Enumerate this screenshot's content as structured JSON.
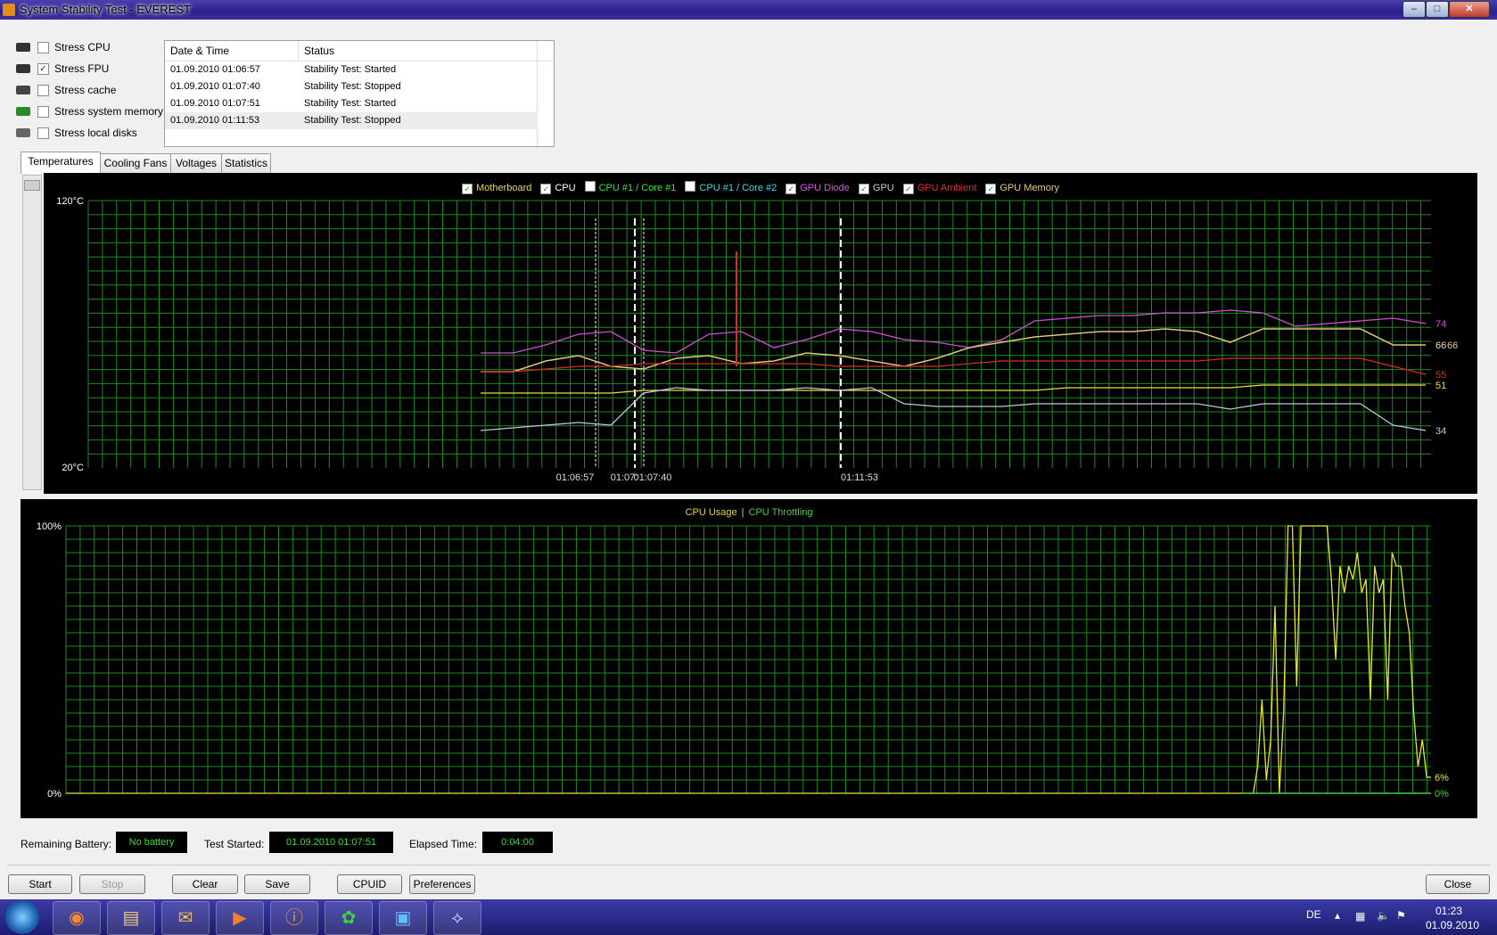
{
  "window": {
    "title": "System Stability Test - EVEREST"
  },
  "stress_options": [
    {
      "label": "Stress CPU",
      "checked": false,
      "icon": "cpu-chip-icon"
    },
    {
      "label": "Stress FPU",
      "checked": true,
      "icon": "fpu-chip-icon"
    },
    {
      "label": "Stress cache",
      "checked": false,
      "icon": "cache-chip-icon"
    },
    {
      "label": "Stress system memory",
      "checked": false,
      "icon": "memory-module-icon"
    },
    {
      "label": "Stress local disks",
      "checked": false,
      "icon": "disk-drive-icon"
    }
  ],
  "log": {
    "columns": [
      "Date & Time",
      "Status"
    ],
    "rows": [
      [
        "01.09.2010 01:06:57",
        "Stability Test: Started"
      ],
      [
        "01.09.2010 01:07:40",
        "Stability Test: Stopped"
      ],
      [
        "01.09.2010 01:07:51",
        "Stability Test: Started"
      ],
      [
        "01.09.2010 01:11:53",
        "Stability Test: Stopped"
      ]
    ]
  },
  "tabs": [
    "Temperatures",
    "Cooling Fans",
    "Voltages",
    "Statistics"
  ],
  "active_tab": "Temperatures",
  "chart_data": [
    {
      "type": "line",
      "ylim": [
        20,
        120
      ],
      "ymax_label": "120°C",
      "ymin_label": "20°C",
      "x_markers": [
        "01:06:57",
        "01:07:",
        "01:07:40",
        "01:11:53"
      ],
      "legend": [
        {
          "name": "Motherboard",
          "checked": true,
          "color": "#e8d84a"
        },
        {
          "name": "CPU",
          "checked": true,
          "color": "#ffffff"
        },
        {
          "name": "CPU #1 / Core #1",
          "checked": false,
          "color": "#3fe03f"
        },
        {
          "name": "CPU #1 / Core #2",
          "checked": false,
          "color": "#40d8e8"
        },
        {
          "name": "GPU Diode",
          "checked": true,
          "color": "#e050e0"
        },
        {
          "name": "GPU",
          "checked": true,
          "color": "#c8c8c8"
        },
        {
          "name": "GPU Ambient",
          "checked": true,
          "color": "#e03030"
        },
        {
          "name": "GPU Memory",
          "checked": true,
          "color": "#e8c878"
        }
      ],
      "series": [
        {
          "name": "GPU Diode",
          "color": "#d050d0",
          "end_label": "74",
          "values": [
            63,
            63,
            66,
            70,
            71,
            64,
            63,
            70,
            71,
            65,
            68,
            72,
            71,
            68,
            67,
            65,
            68,
            75,
            76,
            77,
            77,
            78,
            78,
            79,
            78,
            73,
            74,
            75,
            76,
            74
          ]
        },
        {
          "name": "GPU",
          "color": "#e8e0c0",
          "end_label": "66",
          "values": [
            56,
            56,
            60,
            62,
            58,
            57,
            61,
            62,
            59,
            60,
            63,
            62,
            60,
            58,
            61,
            65,
            67,
            69,
            70,
            71,
            71,
            72,
            71,
            67,
            72,
            72,
            72,
            72,
            66,
            66
          ]
        },
        {
          "name": "GPU Memory",
          "color": "#e8c878",
          "end_label": "66",
          "values": [
            56,
            56,
            60,
            62,
            58,
            57,
            61,
            62,
            59,
            60,
            63,
            62,
            60,
            58,
            61,
            65,
            67,
            69,
            70,
            71,
            71,
            72,
            71,
            67,
            72,
            72,
            72,
            72,
            66,
            66
          ]
        },
        {
          "name": "GPU Ambient",
          "color": "#d03020",
          "end_label": "55",
          "values": [
            56,
            56,
            57,
            58,
            58,
            59,
            59,
            59,
            59,
            59,
            59,
            58,
            58,
            58,
            58,
            59,
            60,
            60,
            60,
            60,
            60,
            60,
            60,
            61,
            61,
            61,
            61,
            61,
            58,
            55
          ]
        },
        {
          "name": "Motherboard",
          "color": "#e8e040",
          "end_label": "51",
          "values": [
            48,
            48,
            48,
            48,
            48,
            49,
            49,
            49,
            49,
            49,
            49,
            49,
            49,
            49,
            49,
            49,
            49,
            49,
            50,
            50,
            50,
            50,
            50,
            50,
            51,
            51,
            51,
            51,
            51,
            51
          ]
        },
        {
          "name": "CPU",
          "color": "#b8c8e0",
          "end_label": "34",
          "values": [
            34,
            35,
            36,
            37,
            36,
            48,
            50,
            49,
            49,
            49,
            50,
            49,
            50,
            44,
            43,
            43,
            43,
            44,
            44,
            44,
            44,
            44,
            44,
            42,
            44,
            44,
            44,
            44,
            36,
            34
          ]
        }
      ],
      "spike": {
        "name": "GPU Ambient",
        "value": 101
      }
    },
    {
      "type": "line",
      "ylim": [
        0,
        100
      ],
      "ymax_label": "100%",
      "ymin_label": "0%",
      "legend": [
        {
          "name": "CPU Usage",
          "color": "#e8d830"
        },
        {
          "name": "CPU Throttling",
          "color": "#3fd03f"
        }
      ],
      "series": [
        {
          "name": "CPU Usage",
          "color": "#e8e830",
          "end_label": "6%",
          "values": [
            0,
            0,
            0,
            0,
            0,
            0,
            0,
            0,
            0,
            0,
            0,
            0,
            0,
            0,
            0,
            0,
            0,
            0,
            0,
            0,
            0,
            0,
            0,
            0,
            0,
            0,
            0,
            0,
            0,
            0,
            0,
            0,
            0,
            0,
            0,
            0,
            0,
            0,
            0,
            0,
            0,
            0,
            0,
            0,
            0,
            0,
            0,
            0,
            0,
            0,
            0,
            0,
            0,
            0,
            0,
            0,
            0,
            0,
            0,
            0,
            0,
            0,
            0,
            0,
            0,
            0,
            0,
            0,
            0,
            0,
            0,
            0,
            0,
            0,
            0,
            0,
            0,
            0,
            0,
            0,
            0,
            0,
            0,
            0,
            0,
            0,
            0,
            0,
            0,
            0,
            0,
            0,
            0,
            0,
            0,
            0,
            0,
            0,
            0,
            0,
            0,
            0,
            0,
            0,
            0,
            0,
            0,
            0,
            0,
            0,
            0,
            0,
            0,
            0,
            0,
            0,
            0,
            0,
            0,
            0,
            0,
            0,
            0,
            0,
            0,
            0,
            0,
            0,
            0,
            0,
            0,
            0,
            0,
            0,
            0,
            0,
            0,
            0,
            0,
            0,
            0,
            0,
            0,
            0,
            0,
            0,
            0,
            0,
            0,
            0,
            0,
            0,
            0,
            0,
            0,
            0,
            0,
            0,
            0,
            0,
            0,
            0,
            0,
            0,
            0,
            0,
            0,
            0,
            0,
            0,
            0,
            0,
            0,
            0,
            0,
            0,
            0,
            0,
            0,
            0,
            0,
            0,
            0,
            0,
            0,
            0,
            0,
            0,
            0,
            0,
            0,
            0,
            0,
            0,
            0,
            0,
            0,
            0,
            0,
            0,
            0,
            0,
            0,
            0,
            0,
            0,
            0,
            0,
            0,
            0,
            0,
            0,
            0,
            0,
            0,
            0,
            0,
            0,
            0,
            0,
            0,
            0,
            0,
            0,
            0,
            0,
            0,
            0,
            0,
            0,
            0,
            0,
            0,
            0,
            0,
            0,
            0,
            0,
            0,
            0,
            0,
            0,
            0,
            0,
            0,
            0,
            0,
            0,
            0,
            0,
            0,
            0,
            0,
            0,
            0,
            0,
            0,
            0,
            0,
            0,
            0,
            0,
            0,
            0,
            0,
            0,
            0,
            0,
            0,
            0,
            0,
            0,
            0,
            0,
            0,
            10,
            35,
            5,
            20,
            70,
            0,
            30,
            100,
            100,
            40,
            100,
            100,
            100,
            100,
            100,
            100,
            100,
            80,
            50,
            85,
            75,
            85,
            80,
            90,
            75,
            80,
            35,
            85,
            75,
            80,
            35,
            90,
            85,
            85,
            70,
            60,
            30,
            10,
            20,
            6,
            6
          ]
        },
        {
          "name": "CPU Throttling",
          "color": "#3fd03f",
          "end_label": "0%",
          "values": []
        }
      ]
    }
  ],
  "status": {
    "battery_label": "Remaining Battery:",
    "battery_value": "No battery",
    "started_label": "Test Started:",
    "started_value": "01.09.2010 01:07:51",
    "elapsed_label": "Elapsed Time:",
    "elapsed_value": "0:04:00"
  },
  "buttons": {
    "start": "Start",
    "stop": "Stop",
    "clear": "Clear",
    "save": "Save",
    "cpuid": "CPUID",
    "preferences": "Preferences",
    "close": "Close"
  },
  "taskbar": {
    "lang": "DE",
    "time": "01:23",
    "date": "01.09.2010",
    "items": [
      "firefox-icon",
      "explorer-folder-icon",
      "mail-icon",
      "media-player-icon",
      "everest-info-icon",
      "icq-flower-icon",
      "system-monitor-icon",
      "stability-test-icon"
    ]
  }
}
